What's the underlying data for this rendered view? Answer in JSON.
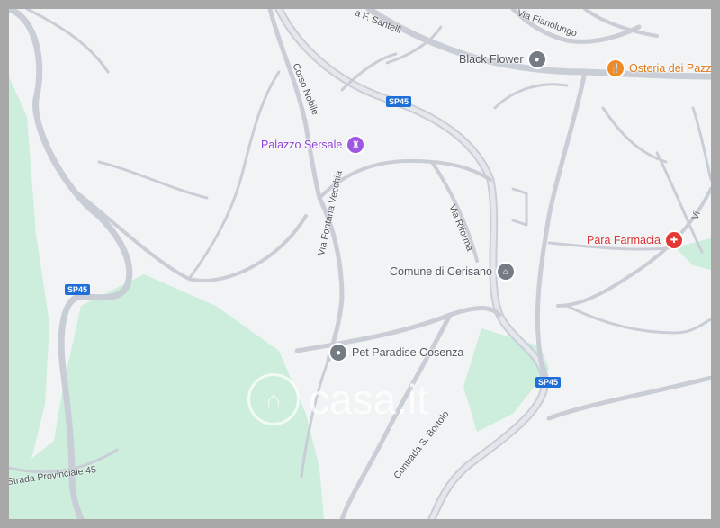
{
  "map": {
    "pois": [
      {
        "name": "Black Flower",
        "icon": "pin-icon",
        "color": "#757b83",
        "label_color": "#50565e"
      },
      {
        "name": "Osteria dei Pazz",
        "icon": "fork-knife-icon",
        "color": "#f08a24",
        "label_color": "#e07a18"
      },
      {
        "name": "Palazzo Sersale",
        "icon": "castle-icon",
        "color": "#9d57e0",
        "label_color": "#9140d8"
      },
      {
        "name": "Comune di Cerisano",
        "icon": "bank-icon",
        "color": "#757b83",
        "label_color": "#50565e"
      },
      {
        "name": "Para Farmacia",
        "icon": "pharmacy-icon",
        "color": "#e53935",
        "label_color": "#d93434"
      },
      {
        "name": "Pet Paradise Cosenza",
        "icon": "pin-icon",
        "color": "#757b83",
        "label_color": "#50565e"
      }
    ],
    "streets": {
      "via_f_santelli": "a F. Santelli",
      "via_fianolungo": "Via Fianolungo",
      "corso_nobile": "Corso Nobile",
      "via_fontana_vecchia": "Via Fontana Vecchia",
      "via_riforma": "Via Riforma",
      "contrada_s_bortolo": "Contrada S. Bortolo",
      "strada_provinciale_45": "Strada Provinciale 45",
      "via_edge": "Vi"
    },
    "shields": [
      "SP45",
      "SP45",
      "SP45"
    ],
    "watermark": "casa.it",
    "colors": {
      "road": "#c9ced6",
      "park": "#cdeedd",
      "background": "#f2f3f5",
      "shield": "#1f6fd8"
    }
  }
}
